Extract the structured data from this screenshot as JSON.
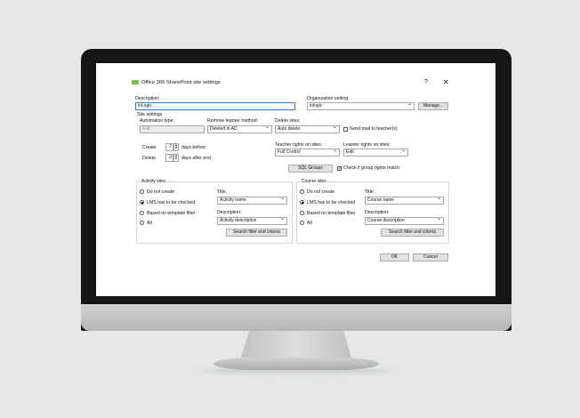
{
  "dialog": {
    "title": "Office 365 SharePoint site settings",
    "help": "?",
    "close": "✕",
    "description_label": "Description:",
    "description_value": "inLogic",
    "org_label": "Organization setting:",
    "org_value": "inlogic",
    "manage_label": "Manage...",
    "site_settings_label": "Site settings",
    "automation_label": "Automation type:",
    "automation_value": "Full",
    "remove_label": "Remove learner method:",
    "remove_value": "Deleted in AD",
    "delete_sites_label": "Delete sites:",
    "delete_sites_value": "Auto delete",
    "send_mail_label": "Send mail to teacher(s)",
    "create_label": "Create",
    "create_value": "7",
    "days_before": "days before",
    "delete_label": "Delete",
    "delete_value": "0",
    "days_after": "days after end",
    "teacher_rights_label": "Teacher rights on sites:",
    "teacher_rights_value": "Full Control",
    "learner_rights_label": "Learner rights on sites:",
    "learner_rights_value": "Edit",
    "sql_groups": "SQL Groups",
    "check_group_label": "Check if group rights match",
    "activity": {
      "legend": "Activity sites",
      "opt_not_create": "Do not create",
      "opt_lms": "LMS has to be checked",
      "opt_template": "Based on template filter",
      "opt_all": "All",
      "title_label": "Title:",
      "title_value": "Activity name",
      "desc_label": "Description:",
      "desc_value": "Activity description",
      "search_btn": "Search filter and criteria"
    },
    "course": {
      "legend": "Course sites",
      "opt_not_create": "Do not create",
      "opt_lms": "LMS has to be checked",
      "opt_template": "Based on template filter",
      "opt_all": "All",
      "title_label": "Title:",
      "title_value": "Course name",
      "desc_label": "Description:",
      "desc_value": "Course description",
      "search_btn": "Search filter and criteria"
    },
    "ok": "OK",
    "cancel": "Cancel"
  }
}
